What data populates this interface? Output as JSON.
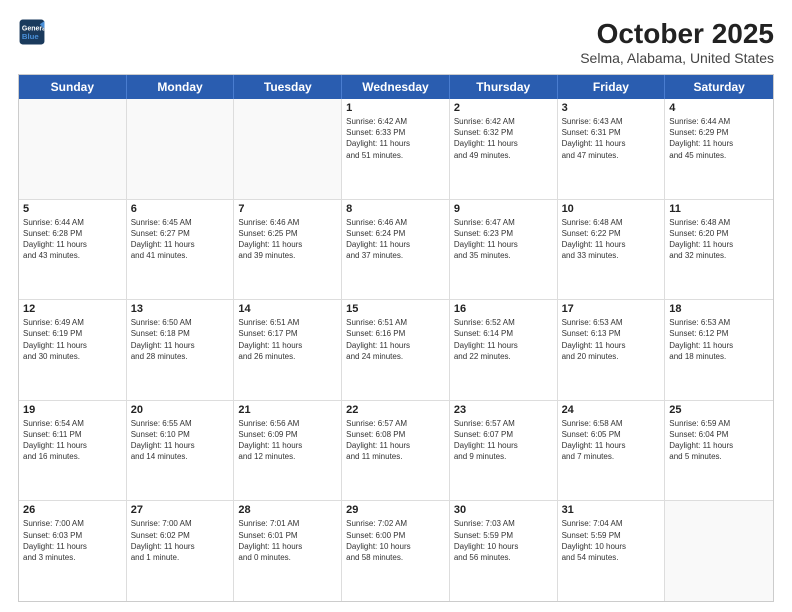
{
  "header": {
    "logo_line1": "General",
    "logo_line2": "Blue",
    "month_title": "October 2025",
    "location": "Selma, Alabama, United States"
  },
  "day_headers": [
    "Sunday",
    "Monday",
    "Tuesday",
    "Wednesday",
    "Thursday",
    "Friday",
    "Saturday"
  ],
  "weeks": [
    [
      {
        "num": "",
        "info": ""
      },
      {
        "num": "",
        "info": ""
      },
      {
        "num": "",
        "info": ""
      },
      {
        "num": "1",
        "info": "Sunrise: 6:42 AM\nSunset: 6:33 PM\nDaylight: 11 hours\nand 51 minutes."
      },
      {
        "num": "2",
        "info": "Sunrise: 6:42 AM\nSunset: 6:32 PM\nDaylight: 11 hours\nand 49 minutes."
      },
      {
        "num": "3",
        "info": "Sunrise: 6:43 AM\nSunset: 6:31 PM\nDaylight: 11 hours\nand 47 minutes."
      },
      {
        "num": "4",
        "info": "Sunrise: 6:44 AM\nSunset: 6:29 PM\nDaylight: 11 hours\nand 45 minutes."
      }
    ],
    [
      {
        "num": "5",
        "info": "Sunrise: 6:44 AM\nSunset: 6:28 PM\nDaylight: 11 hours\nand 43 minutes."
      },
      {
        "num": "6",
        "info": "Sunrise: 6:45 AM\nSunset: 6:27 PM\nDaylight: 11 hours\nand 41 minutes."
      },
      {
        "num": "7",
        "info": "Sunrise: 6:46 AM\nSunset: 6:25 PM\nDaylight: 11 hours\nand 39 minutes."
      },
      {
        "num": "8",
        "info": "Sunrise: 6:46 AM\nSunset: 6:24 PM\nDaylight: 11 hours\nand 37 minutes."
      },
      {
        "num": "9",
        "info": "Sunrise: 6:47 AM\nSunset: 6:23 PM\nDaylight: 11 hours\nand 35 minutes."
      },
      {
        "num": "10",
        "info": "Sunrise: 6:48 AM\nSunset: 6:22 PM\nDaylight: 11 hours\nand 33 minutes."
      },
      {
        "num": "11",
        "info": "Sunrise: 6:48 AM\nSunset: 6:20 PM\nDaylight: 11 hours\nand 32 minutes."
      }
    ],
    [
      {
        "num": "12",
        "info": "Sunrise: 6:49 AM\nSunset: 6:19 PM\nDaylight: 11 hours\nand 30 minutes."
      },
      {
        "num": "13",
        "info": "Sunrise: 6:50 AM\nSunset: 6:18 PM\nDaylight: 11 hours\nand 28 minutes."
      },
      {
        "num": "14",
        "info": "Sunrise: 6:51 AM\nSunset: 6:17 PM\nDaylight: 11 hours\nand 26 minutes."
      },
      {
        "num": "15",
        "info": "Sunrise: 6:51 AM\nSunset: 6:16 PM\nDaylight: 11 hours\nand 24 minutes."
      },
      {
        "num": "16",
        "info": "Sunrise: 6:52 AM\nSunset: 6:14 PM\nDaylight: 11 hours\nand 22 minutes."
      },
      {
        "num": "17",
        "info": "Sunrise: 6:53 AM\nSunset: 6:13 PM\nDaylight: 11 hours\nand 20 minutes."
      },
      {
        "num": "18",
        "info": "Sunrise: 6:53 AM\nSunset: 6:12 PM\nDaylight: 11 hours\nand 18 minutes."
      }
    ],
    [
      {
        "num": "19",
        "info": "Sunrise: 6:54 AM\nSunset: 6:11 PM\nDaylight: 11 hours\nand 16 minutes."
      },
      {
        "num": "20",
        "info": "Sunrise: 6:55 AM\nSunset: 6:10 PM\nDaylight: 11 hours\nand 14 minutes."
      },
      {
        "num": "21",
        "info": "Sunrise: 6:56 AM\nSunset: 6:09 PM\nDaylight: 11 hours\nand 12 minutes."
      },
      {
        "num": "22",
        "info": "Sunrise: 6:57 AM\nSunset: 6:08 PM\nDaylight: 11 hours\nand 11 minutes."
      },
      {
        "num": "23",
        "info": "Sunrise: 6:57 AM\nSunset: 6:07 PM\nDaylight: 11 hours\nand 9 minutes."
      },
      {
        "num": "24",
        "info": "Sunrise: 6:58 AM\nSunset: 6:05 PM\nDaylight: 11 hours\nand 7 minutes."
      },
      {
        "num": "25",
        "info": "Sunrise: 6:59 AM\nSunset: 6:04 PM\nDaylight: 11 hours\nand 5 minutes."
      }
    ],
    [
      {
        "num": "26",
        "info": "Sunrise: 7:00 AM\nSunset: 6:03 PM\nDaylight: 11 hours\nand 3 minutes."
      },
      {
        "num": "27",
        "info": "Sunrise: 7:00 AM\nSunset: 6:02 PM\nDaylight: 11 hours\nand 1 minute."
      },
      {
        "num": "28",
        "info": "Sunrise: 7:01 AM\nSunset: 6:01 PM\nDaylight: 11 hours\nand 0 minutes."
      },
      {
        "num": "29",
        "info": "Sunrise: 7:02 AM\nSunset: 6:00 PM\nDaylight: 10 hours\nand 58 minutes."
      },
      {
        "num": "30",
        "info": "Sunrise: 7:03 AM\nSunset: 5:59 PM\nDaylight: 10 hours\nand 56 minutes."
      },
      {
        "num": "31",
        "info": "Sunrise: 7:04 AM\nSunset: 5:59 PM\nDaylight: 10 hours\nand 54 minutes."
      },
      {
        "num": "",
        "info": ""
      }
    ]
  ]
}
